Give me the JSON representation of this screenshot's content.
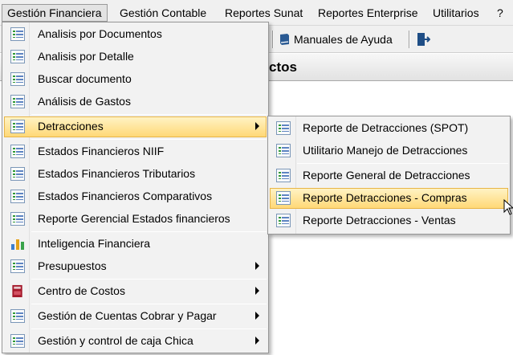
{
  "menubar": {
    "items": [
      {
        "label": "Gestión Financiera"
      },
      {
        "label": "Gestión Contable"
      },
      {
        "label": "Reportes Sunat"
      },
      {
        "label": "Reportes Enterprise"
      },
      {
        "label": "Utilitarios"
      },
      {
        "label": "?"
      }
    ]
  },
  "toolbar": {
    "manuals_label": "Manuales de Ayuda",
    "icons": [
      "book-icon",
      "exit-door-icon"
    ]
  },
  "panel": {
    "title_fragment": "ctos"
  },
  "main_menu": {
    "items": [
      {
        "label": "Analisis por Documentos",
        "icon": "list-icon"
      },
      {
        "label": "Analisis por Detalle",
        "icon": "list-icon"
      },
      {
        "label": "Buscar documento",
        "icon": "list-icon"
      },
      {
        "label": "Análisis de Gastos",
        "icon": "list-icon"
      },
      {
        "label": "Detracciones",
        "icon": "list-icon",
        "submenu": true,
        "highlighted": true
      },
      {
        "label": "Estados Financieros NIIF",
        "icon": "list-icon"
      },
      {
        "label": "Estados Financieros Tributarios",
        "icon": "list-icon"
      },
      {
        "label": "Estados Financieros Comparativos",
        "icon": "list-icon"
      },
      {
        "label": "Reporte Gerencial Estados financieros",
        "icon": "list-icon"
      },
      {
        "label": "Inteligencia Financiera",
        "icon": "bar-chart-icon"
      },
      {
        "label": "Presupuestos",
        "icon": "list-icon",
        "submenu": true
      },
      {
        "label": "Centro de Costos",
        "icon": "book-red-icon",
        "submenu": true
      },
      {
        "label": "Gestión de Cuentas Cobrar y Pagar",
        "icon": "list-icon",
        "submenu": true
      },
      {
        "label": "Gestión y control de caja Chica",
        "icon": "list-icon",
        "submenu": true
      }
    ]
  },
  "sub_menu": {
    "items": [
      {
        "label": "Reporte de Detracciones (SPOT)",
        "icon": "list-icon"
      },
      {
        "label": "Utilitario Manejo de Detracciones",
        "icon": "list-icon"
      },
      {
        "label": "Reporte General de Detracciones",
        "icon": "list-icon"
      },
      {
        "label": "Reporte Detracciones - Compras",
        "icon": "list-icon",
        "highlighted": true
      },
      {
        "label": "Reporte Detracciones - Ventas",
        "icon": "list-icon"
      }
    ]
  },
  "colors": {
    "highlight_top": "#fff3c4",
    "highlight_bottom": "#ffd877",
    "highlight_border": "#e8b547",
    "menu_bg": "#f2f2f2"
  }
}
